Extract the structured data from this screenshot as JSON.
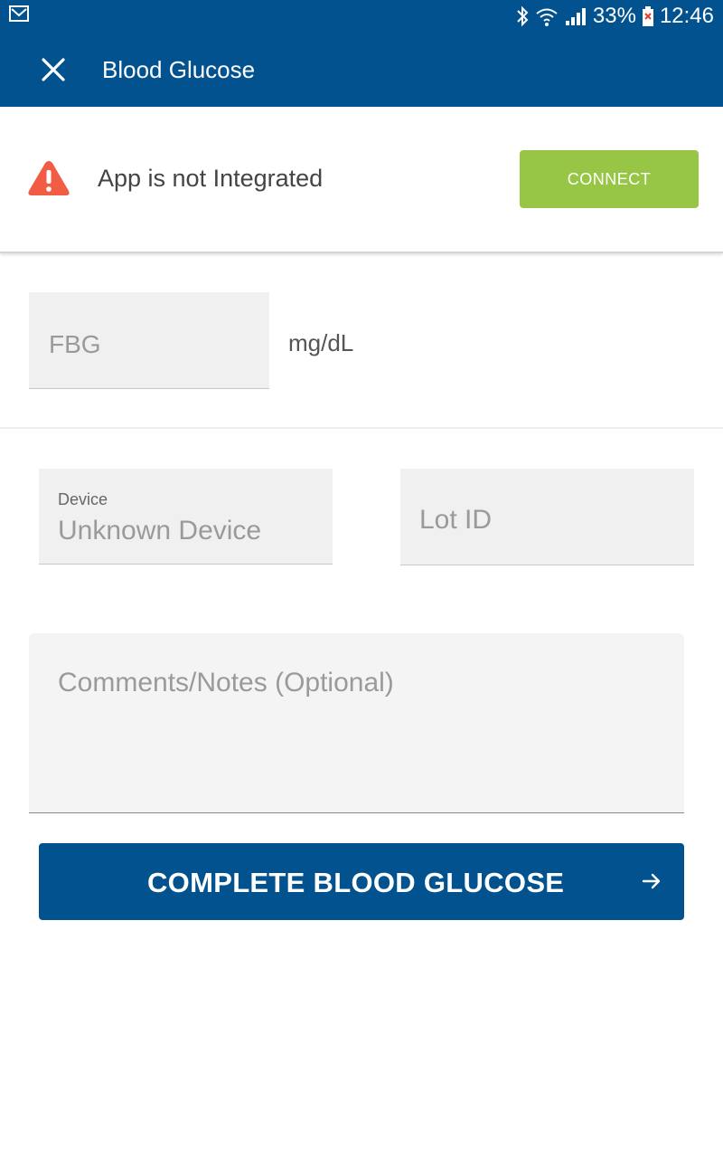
{
  "status_bar": {
    "battery": "33%",
    "time": "12:46",
    "icons": [
      "mail-icon",
      "bluetooth-icon",
      "wifi-icon",
      "signal-icon",
      "battery-icon"
    ]
  },
  "app_bar": {
    "title": "Blood Glucose",
    "close_icon": "close-icon",
    "color": "#02528f"
  },
  "banner": {
    "message": "App is not Integrated",
    "icon": "warning-icon",
    "icon_color": "#f25c45",
    "connect_label": "CONNECT",
    "connect_color": "#97c646"
  },
  "form": {
    "fbg_placeholder": "FBG",
    "fbg_unit": "mg/dL",
    "device_label": "Device",
    "device_value": "Unknown Device",
    "lot_placeholder": "Lot ID",
    "notes_placeholder": "Comments/Notes (Optional)"
  },
  "submit": {
    "label": "COMPLETE BLOOD GLUCOSE",
    "icon": "arrow-right-icon"
  }
}
